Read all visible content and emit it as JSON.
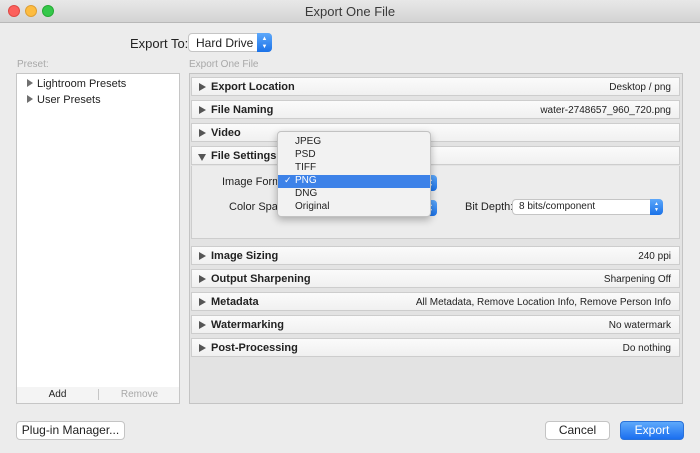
{
  "window": {
    "title": "Export One File"
  },
  "export_to": {
    "label": "Export To:",
    "value": "Hard Drive"
  },
  "preset_panel": {
    "label": "Preset:",
    "items": [
      {
        "label": "Lightroom Presets"
      },
      {
        "label": "User Presets"
      }
    ],
    "add_label": "Add",
    "remove_label": "Remove"
  },
  "main": {
    "label": "Export One File",
    "sections": [
      {
        "title": "Export Location",
        "summary": "Desktop / png"
      },
      {
        "title": "File Naming",
        "summary": "water-2748657_960_720.png"
      },
      {
        "title": "Video",
        "summary": ""
      },
      {
        "title": "File Settings",
        "summary": ""
      },
      {
        "title": "Image Sizing",
        "summary": "240 ppi"
      },
      {
        "title": "Output Sharpening",
        "summary": "Sharpening Off"
      },
      {
        "title": "Metadata",
        "summary": "All Metadata, Remove Location Info, Remove Person Info"
      },
      {
        "title": "Watermarking",
        "summary": "No watermark"
      },
      {
        "title": "Post-Processing",
        "summary": "Do nothing"
      }
    ],
    "file_settings": {
      "image_format_label": "Image Format:",
      "color_space_label": "Color Space:",
      "bit_depth_label": "Bit Depth:",
      "bit_depth_value": "8 bits/component"
    }
  },
  "format_dropdown": {
    "options": [
      "JPEG",
      "PSD",
      "TIFF",
      "PNG",
      "DNG",
      "Original"
    ],
    "selected": "PNG",
    "check": "✓"
  },
  "footer": {
    "plugin_manager_label": "Plug-in Manager...",
    "cancel_label": "Cancel",
    "export_label": "Export"
  },
  "colors": {
    "accent": "#3d82e8",
    "primary_button": "#1b6ff0"
  }
}
